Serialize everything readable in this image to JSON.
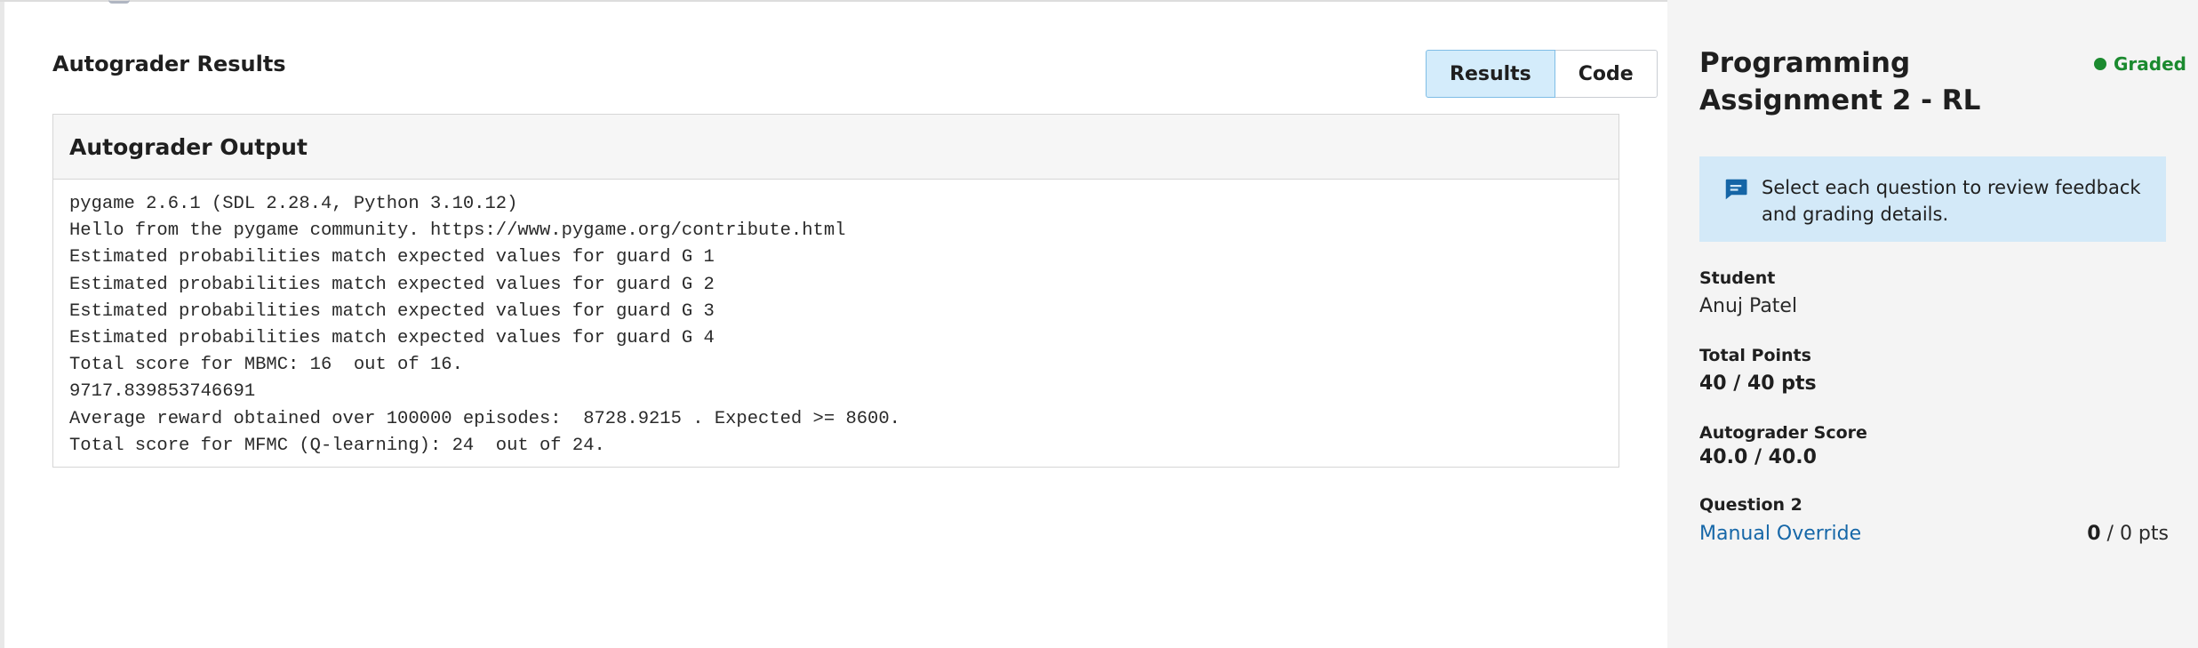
{
  "main": {
    "title": "Autograder Results",
    "tabs": [
      {
        "label": "Results",
        "active": true
      },
      {
        "label": "Code",
        "active": false
      }
    ],
    "output": {
      "header": "Autograder Output",
      "lines": [
        "pygame 2.6.1 (SDL 2.28.4, Python 3.10.12)",
        "Hello from the pygame community. https://www.pygame.org/contribute.html",
        "Estimated probabilities match expected values for guard G 1",
        "Estimated probabilities match expected values for guard G 2",
        "Estimated probabilities match expected values for guard G 3",
        "Estimated probabilities match expected values for guard G 4",
        "Total score for MBMC: 16  out of 16.",
        "9717.839853746691",
        "Average reward obtained over 100000 episodes:  8728.9215 . Expected >= 8600.",
        "Total score for MFMC (Q-learning): 24  out of 24."
      ]
    }
  },
  "sidebar": {
    "assignment_title": "Programming Assignment 2 - RL",
    "status": "Graded",
    "status_color": "#1b8a2f",
    "notice": {
      "icon": "chat-bubble-icon",
      "text": "Select each question to review feedback and grading details."
    },
    "student_label": "Student",
    "student_name": "Anuj Patel",
    "total_points_label": "Total Points",
    "total_points_value": "40 / 40 pts",
    "autograder_label": "Autograder Score",
    "autograder_value": "40.0 / 40.0",
    "question_label": "Question 2",
    "question_link": "Manual Override",
    "question_score": "0",
    "question_total": " / 0 pts"
  },
  "colors": {
    "accent_link": "#1667a8",
    "notice_bg": "#d3e9f8",
    "active_tab_bg": "#d4ecfb"
  }
}
